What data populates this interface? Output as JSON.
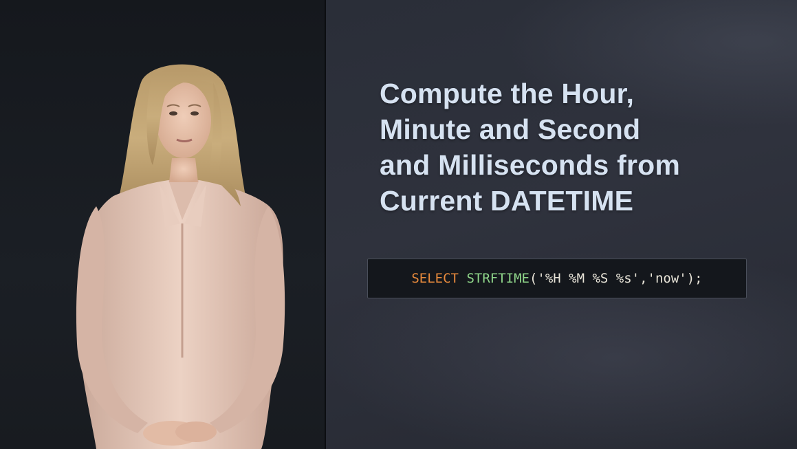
{
  "slide": {
    "title_lines": [
      "Compute the Hour,",
      "Minute and Second",
      "and Milliseconds from",
      "Current DATETIME"
    ],
    "code": {
      "keyword": "SELECT",
      "function": "STRFTIME",
      "args": "('%H %M %S %s','now');"
    }
  },
  "colors": {
    "title": "#d6e2f1",
    "keyword": "#e88a3c",
    "function": "#8fd68a",
    "code_text": "#e8e4d8"
  }
}
